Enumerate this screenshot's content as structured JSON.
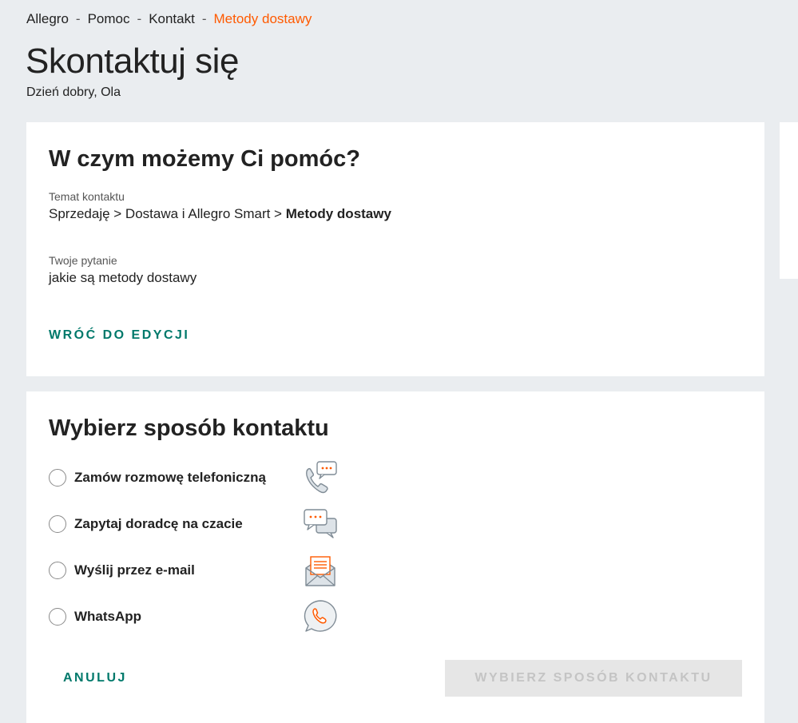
{
  "breadcrumb": {
    "items": [
      "Allegro",
      "Pomoc",
      "Kontakt"
    ],
    "current": "Metody dostawy",
    "separator": "-"
  },
  "page": {
    "title": "Skontaktuj się",
    "greeting": "Dzień dobry, Ola"
  },
  "topic_card": {
    "heading": "W czym możemy Ci pomóc?",
    "topic_label": "Temat kontaktu",
    "topic_path": "Sprzedaję > Dostawa i Allegro Smart > ",
    "topic_current": "Metody dostawy",
    "question_label": "Twoje pytanie",
    "question_value": "jakie są metody dostawy",
    "edit_link": "WRÓĆ DO EDYCJI"
  },
  "contact_card": {
    "heading": "Wybierz sposób kontaktu",
    "options": [
      {
        "label": "Zamów rozmowę telefoniczną",
        "icon": "phone-chat-icon"
      },
      {
        "label": "Zapytaj doradcę na czacie",
        "icon": "chat-bubbles-icon"
      },
      {
        "label": "Wyślij przez e-mail",
        "icon": "email-envelope-icon"
      },
      {
        "label": "WhatsApp",
        "icon": "whatsapp-icon"
      }
    ],
    "cancel_label": "ANULUJ",
    "submit_label": "WYBIERZ SPOSÓB KONTAKTU"
  },
  "colors": {
    "accent_orange": "#ff5a00",
    "link_teal": "#00796b",
    "background": "#eaedf0"
  }
}
